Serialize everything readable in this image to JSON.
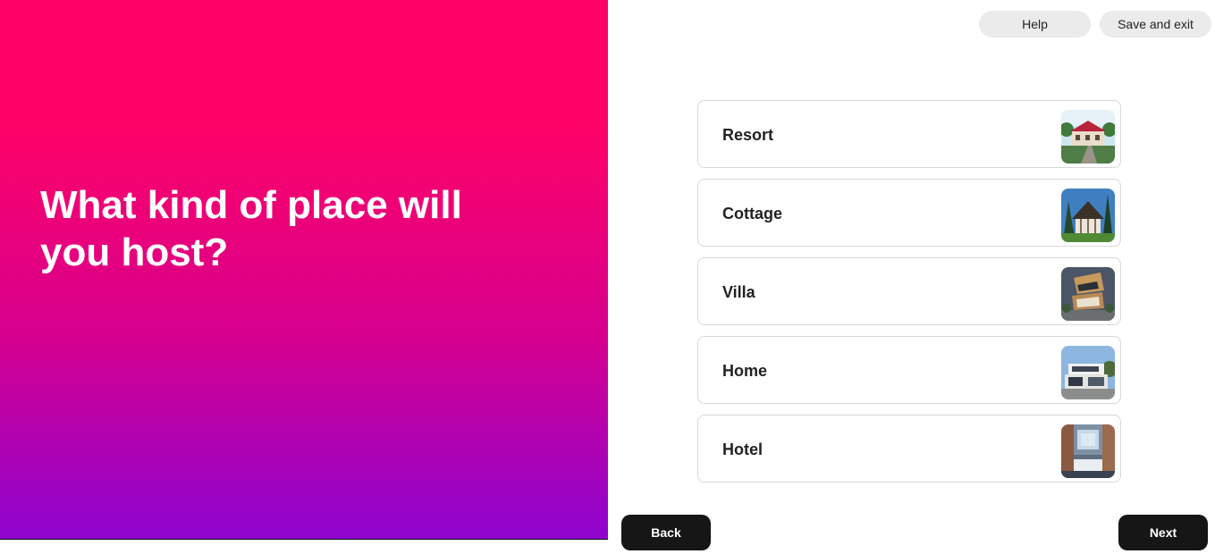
{
  "hero": {
    "title": "What kind of place will you host?"
  },
  "header": {
    "help_label": "Help",
    "save_exit_label": "Save and exit"
  },
  "options": [
    {
      "label": "Resort",
      "icon": "resort-photo"
    },
    {
      "label": "Cottage",
      "icon": "cottage-photo"
    },
    {
      "label": "Villa",
      "icon": "villa-photo"
    },
    {
      "label": "Home",
      "icon": "home-photo"
    },
    {
      "label": "Hotel",
      "icon": "hotel-photo"
    }
  ],
  "footer": {
    "back_label": "Back",
    "next_label": "Next"
  },
  "colors": {
    "gradient_top": "#ff0266",
    "gradient_bottom": "#8e04d0",
    "button_dark": "#161616",
    "pill_bg": "#ebebeb"
  }
}
